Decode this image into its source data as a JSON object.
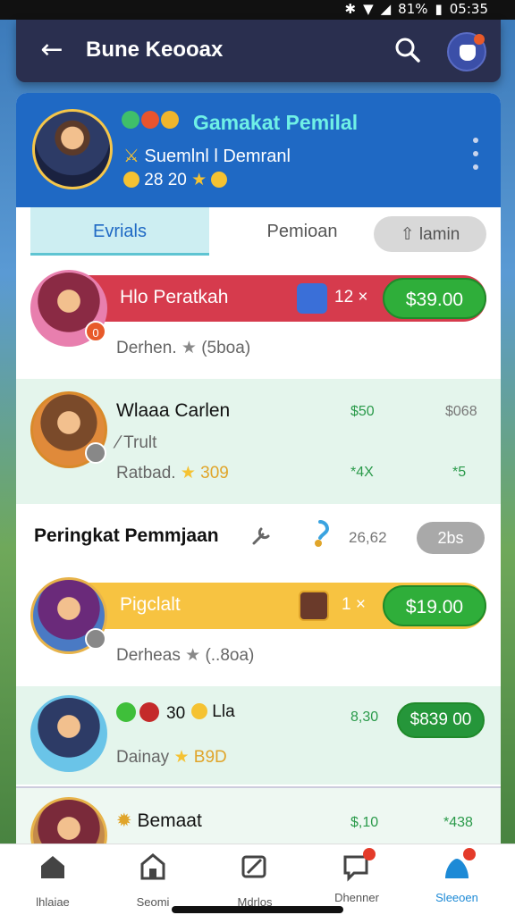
{
  "status_bar": {
    "battery": "81%",
    "time": "05:35"
  },
  "app_bar": {
    "title": "Bune Keooax"
  },
  "profile": {
    "name": "Gamakat Pemilal",
    "subtitle": "Suemlnl l Demranl",
    "stats": "28 20"
  },
  "tabs": [
    {
      "label": "Evrials"
    },
    {
      "label": "Pemioan"
    },
    {
      "label": "lamin"
    }
  ],
  "rows": [
    {
      "name": "Hlo Peratkah",
      "sub": "Derhen.",
      "sub_extra": "(5boa)",
      "qty": "12 ×",
      "price": "$39.00",
      "level": "0"
    },
    {
      "name": "Wlaaa Carlen",
      "line2": "Trult",
      "sub": "Ratbad.",
      "stars": "309",
      "val1": "$50",
      "val2": "$068",
      "val3": "*4X",
      "val4": "*5"
    },
    {
      "name": "Pigclalt",
      "sub": "Derheas",
      "sub_extra": "(..8oa)",
      "qty": "1 ×",
      "price": "$19.00"
    },
    {
      "name": "30",
      "name2": "Lla",
      "sub": "Dainay",
      "stars": "B9D",
      "val1": "8,30",
      "price": "$839 00"
    },
    {
      "name": "Bemaat",
      "val1": "$,10",
      "val2": "*438"
    }
  ],
  "section": {
    "title": "Peringkat Pemmjaan",
    "count": "26,62",
    "pill": "2bs"
  },
  "bottom_nav": [
    {
      "label": "lhlaiae",
      "icon": "home-icon"
    },
    {
      "label": "Seomi",
      "icon": "shop-icon"
    },
    {
      "label": "Mdrlos",
      "icon": "tools-icon"
    },
    {
      "label": "Dhenner",
      "icon": "chat-icon"
    },
    {
      "label": "Sleeoen",
      "icon": "profile-icon"
    }
  ]
}
